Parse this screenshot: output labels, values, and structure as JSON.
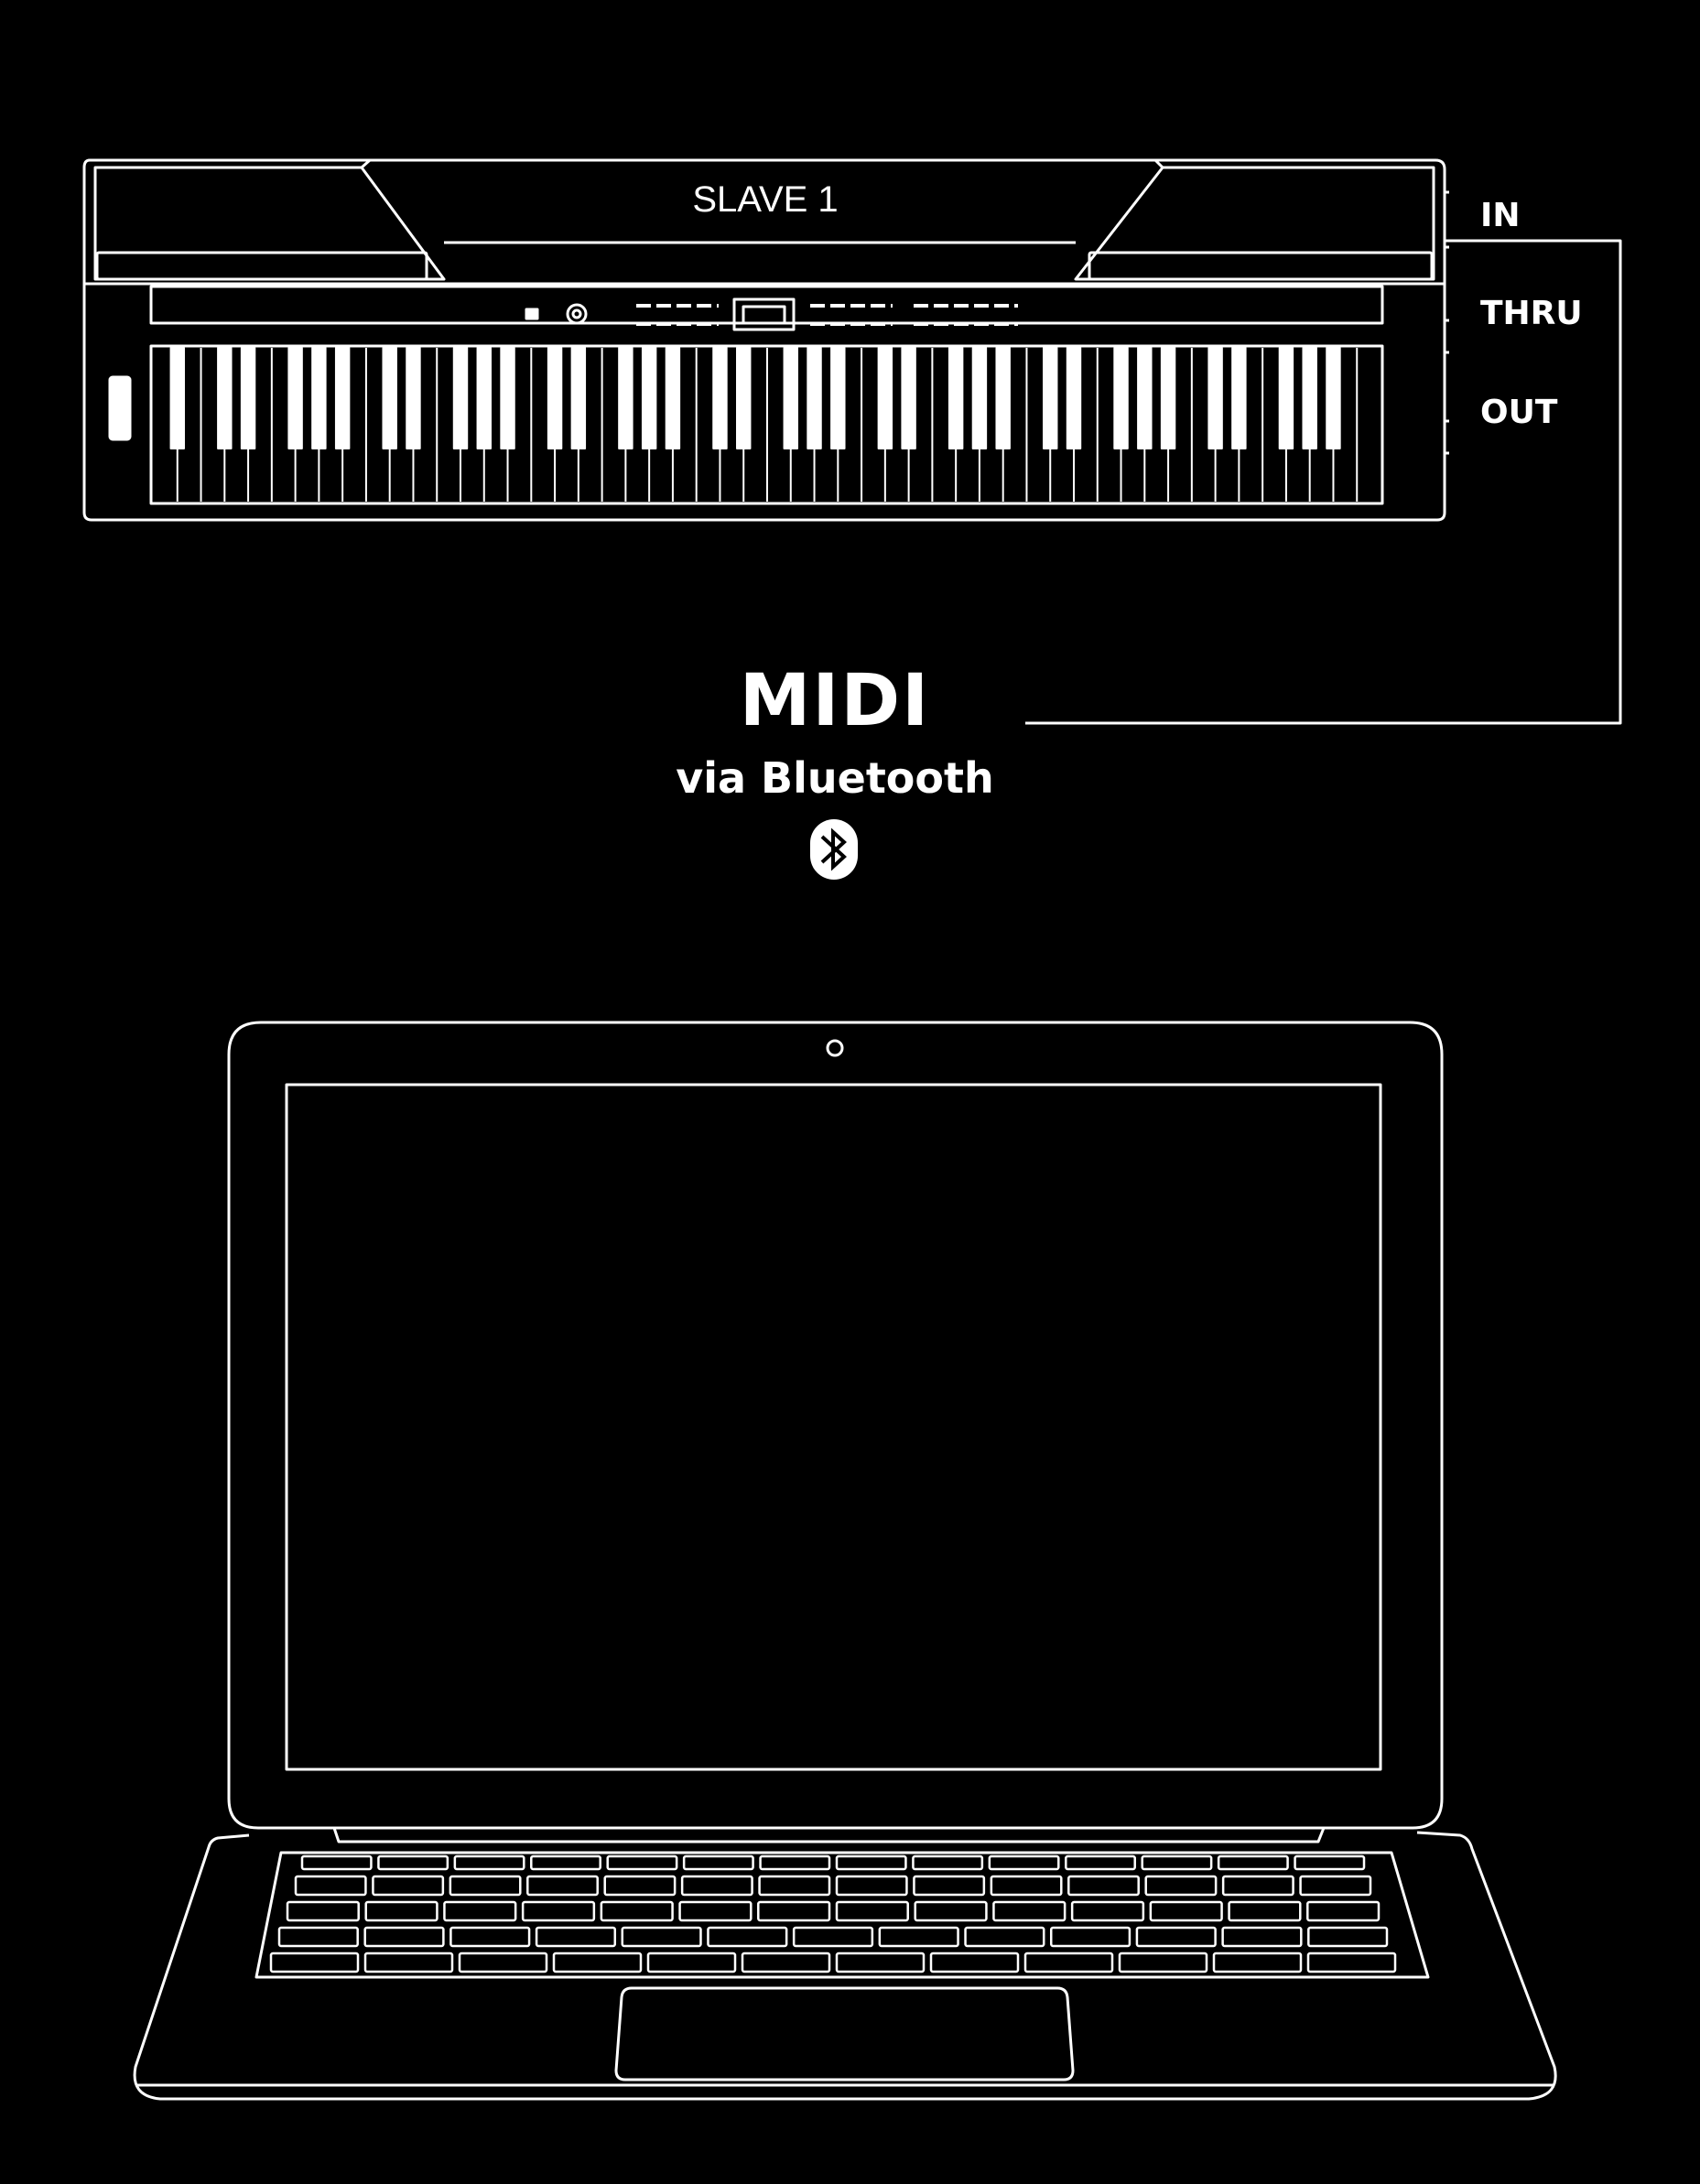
{
  "diagram": {
    "device_label": "SLAVE 1",
    "ports": {
      "in": "IN",
      "thru": "THRU",
      "out": "OUT"
    },
    "connection": {
      "protocol_logo_text": "MIDI",
      "transport_text": "via Bluetooth",
      "icon": "bluetooth-icon"
    }
  },
  "colors": {
    "background": "#000000",
    "line": "#ffffff"
  }
}
